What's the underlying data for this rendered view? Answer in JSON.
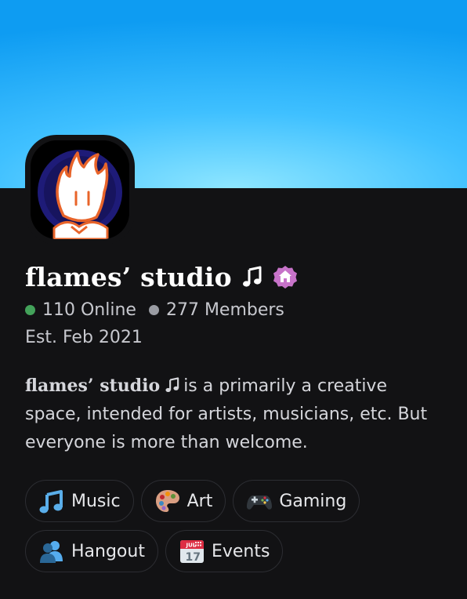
{
  "server": {
    "name": "flames’ studio",
    "title_icon": "musical-note-icon",
    "badge_icon": "community-home-badge-icon",
    "banner_colors": [
      "#0e9cf2",
      "#8ee6ff"
    ],
    "online_text": "110 Online",
    "members_text": "277 Members",
    "online_dot_color": "#43a25a",
    "members_dot_color": "#9a9ca3",
    "established": "Est. Feb 2021"
  },
  "description": {
    "name": "flames’ studio",
    "text_after_name": "is a primarily a creative space, intended for artists, musicians, etc. But everyone is more than welcome."
  },
  "tags": [
    {
      "label": "Music",
      "icon": "musical-notes-icon"
    },
    {
      "label": "Art",
      "icon": "artist-palette-icon"
    },
    {
      "label": "Gaming",
      "icon": "game-controller-icon"
    },
    {
      "label": "Hangout",
      "icon": "people-icon"
    },
    {
      "label": "Events",
      "icon": "calendar-icon",
      "calendar_month": "JUL",
      "calendar_day": "17"
    }
  ]
}
